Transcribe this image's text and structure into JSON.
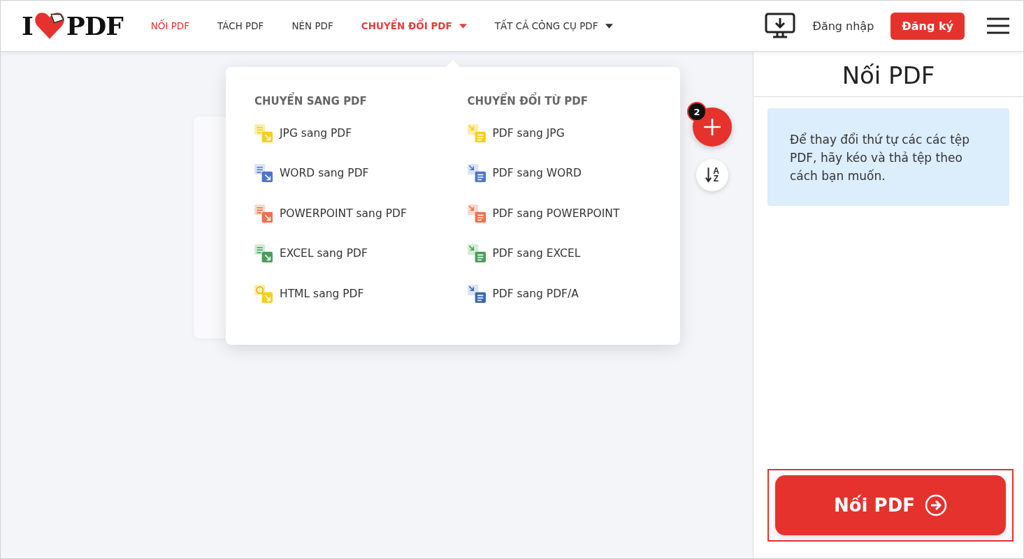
{
  "logo": {
    "left": "I",
    "right": "PDF"
  },
  "nav": [
    {
      "label": "NỐI PDF",
      "selected": true,
      "dropdown": false,
      "expanded": false
    },
    {
      "label": "TÁCH PDF",
      "selected": false,
      "dropdown": false,
      "expanded": false
    },
    {
      "label": "NÉN PDF",
      "selected": false,
      "dropdown": false,
      "expanded": false
    },
    {
      "label": "CHUYỂN ĐỔI PDF",
      "selected": false,
      "dropdown": true,
      "expanded": true
    },
    {
      "label": "TẤT CẢ CÔNG CỤ PDF",
      "selected": false,
      "dropdown": true,
      "expanded": false
    }
  ],
  "header_actions": {
    "login": "Đăng nhập",
    "signup": "Đăng ký"
  },
  "dropdown_menu": {
    "columns": [
      {
        "heading": "CHUYỂN SANG PDF",
        "kind": "to_pdf",
        "items": [
          {
            "label": "JPG sang PDF",
            "kind": "jpg"
          },
          {
            "label": "WORD sang PDF",
            "kind": "word"
          },
          {
            "label": "POWERPOINT sang PDF",
            "kind": "powerpoint"
          },
          {
            "label": "EXCEL sang PDF",
            "kind": "excel"
          },
          {
            "label": "HTML sang PDF",
            "kind": "html"
          }
        ]
      },
      {
        "heading": "CHUYỂN ĐỔI TỪ PDF",
        "kind": "from_pdf",
        "items": [
          {
            "label": "PDF sang JPG",
            "kind": "jpg"
          },
          {
            "label": "PDF sang WORD",
            "kind": "word"
          },
          {
            "label": "PDF sang POWERPOINT",
            "kind": "powerpoint"
          },
          {
            "label": "PDF sang EXCEL",
            "kind": "excel"
          },
          {
            "label": "PDF sang PDF/A",
            "kind": "pdfa"
          }
        ]
      }
    ]
  },
  "add_button": {
    "badge": "2"
  },
  "sort_button": {
    "letters": [
      "A",
      "Z"
    ]
  },
  "sidebar": {
    "title": "Nối PDF",
    "info": "Để thay đổi thứ tự các các tệp PDF, hãy kéo và thả tệp theo cách bạn muốn.",
    "action": "Nối PDF",
    "highlighted": true
  }
}
